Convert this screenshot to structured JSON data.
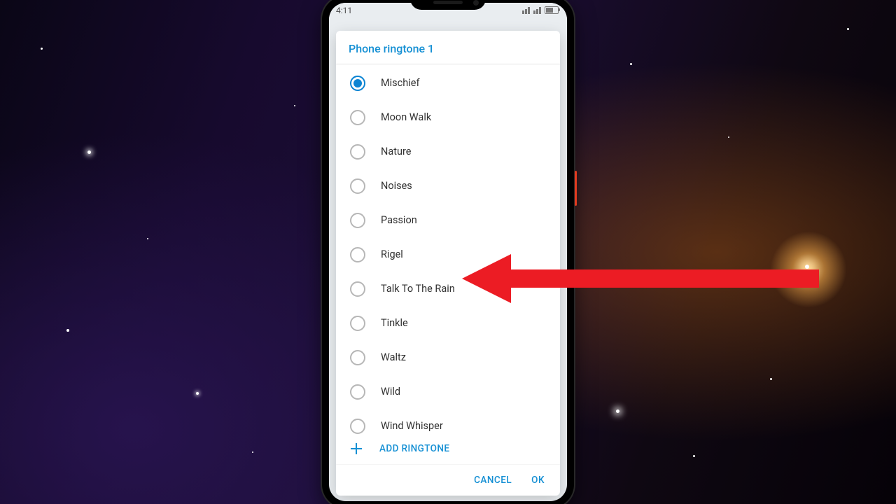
{
  "status": {
    "time": "4:11"
  },
  "dialog": {
    "title": "Phone ringtone 1",
    "items": [
      {
        "label": "Mischief",
        "selected": true
      },
      {
        "label": "Moon Walk",
        "selected": false
      },
      {
        "label": "Nature",
        "selected": false
      },
      {
        "label": "Noises",
        "selected": false
      },
      {
        "label": "Passion",
        "selected": false
      },
      {
        "label": "Rigel",
        "selected": false
      },
      {
        "label": "Talk To The Rain",
        "selected": false
      },
      {
        "label": "Tinkle",
        "selected": false
      },
      {
        "label": "Waltz",
        "selected": false
      },
      {
        "label": "Wild",
        "selected": false
      },
      {
        "label": "Wind Whisper",
        "selected": false
      }
    ],
    "add_label": "ADD RINGTONE",
    "cancel_label": "CANCEL",
    "ok_label": "OK"
  },
  "accent": "#1690d4",
  "arrow_color": "#ec1c24"
}
